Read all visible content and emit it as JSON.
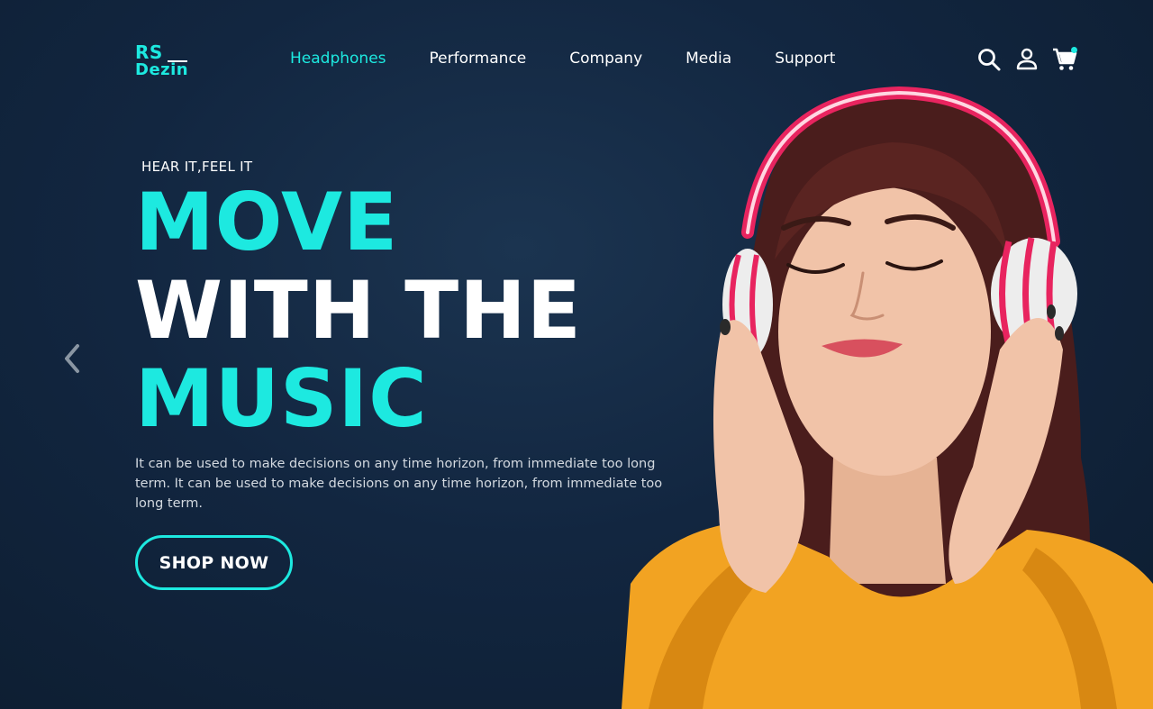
{
  "brand": {
    "line1": "RS",
    "line2": "Dezin"
  },
  "nav": {
    "items": [
      {
        "label": "Headphones",
        "active": true
      },
      {
        "label": "Performance",
        "active": false
      },
      {
        "label": "Company",
        "active": false
      },
      {
        "label": "Media",
        "active": false
      },
      {
        "label": "Support",
        "active": false
      }
    ]
  },
  "header_icons": [
    "search-icon",
    "user-icon",
    "cart-icon"
  ],
  "hero": {
    "eyebrow": "HEAR IT,FEEL IT",
    "headline_line1": "MOVE",
    "headline_line2": "WITH THE",
    "headline_line3": "MUSIC",
    "description": "It can be used to make decisions on any time horizon, from immediate too long term. It can be used to make decisions on any time horizon, from immediate too long term.",
    "cta_label": "SHOP NOW"
  },
  "colors": {
    "accent": "#1de9e0",
    "background": "#122640",
    "text": "#ffffff",
    "sweater": "#f2a322",
    "headphones": "#e8245f"
  }
}
